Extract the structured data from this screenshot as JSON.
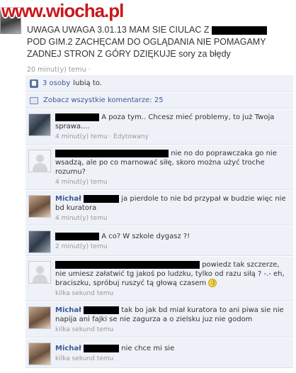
{
  "watermark": "www.wiocha.pl",
  "post": {
    "text_part1": "UWAGA UWAGA 3.01.13 MAM SIE CIULAC Z",
    "text_part2": "POD GIM.2 ZACHĘCAM DO OGLĄDANIA NIE POMAGAMY ZADNEJ STRON Z GÓRY DZIĘKUJE sory za błędy",
    "timestamp": "20 minut(y) temu",
    "meta_sep": "·"
  },
  "likes": {
    "count_link": "3 osoby",
    "suffix": "lubią to."
  },
  "all_comments": {
    "label": "Zobacz wszystkie komentarze: 25"
  },
  "comments": [
    {
      "author": "",
      "text": "A poza tym.. Chcesz mieć problemy, to już Twoja sprawa....",
      "meta": "4 minut(y) temu · Edytowany"
    },
    {
      "author": "",
      "text": "nie no do poprawczaka go nie wsadzą, ale po co marnować siłę, skoro można użyć troche rozumu?",
      "meta": "4 minut(y) temu"
    },
    {
      "author": "Michał",
      "text": "ja pierdole to nie bd przypał w budzie więc nie bd kuratora",
      "meta": "4 minut(y) temu"
    },
    {
      "author": "",
      "text": "A co? W szkole dygasz ?!",
      "meta": "2 minut(y) temu"
    },
    {
      "author": "",
      "text": "powiedz tak szczerze, nie umiesz załatwić tg jakoś po ludzku, tylko od razu siłą ? -.- eh, braciszku, spróbuj ruszyć tą głową czasem",
      "smiley": ":)",
      "meta": "kilka sekund temu"
    },
    {
      "author": "Michał",
      "text": "tak bo jak bd miał kuratora to ani piwa sie nie napija ani fajki se nie zagurza a o zielsku juz nie godom",
      "meta": "kilka sekund temu"
    },
    {
      "author": "Michał",
      "text": "nie chce mi sie",
      "meta": "kilka sekund temu"
    }
  ]
}
